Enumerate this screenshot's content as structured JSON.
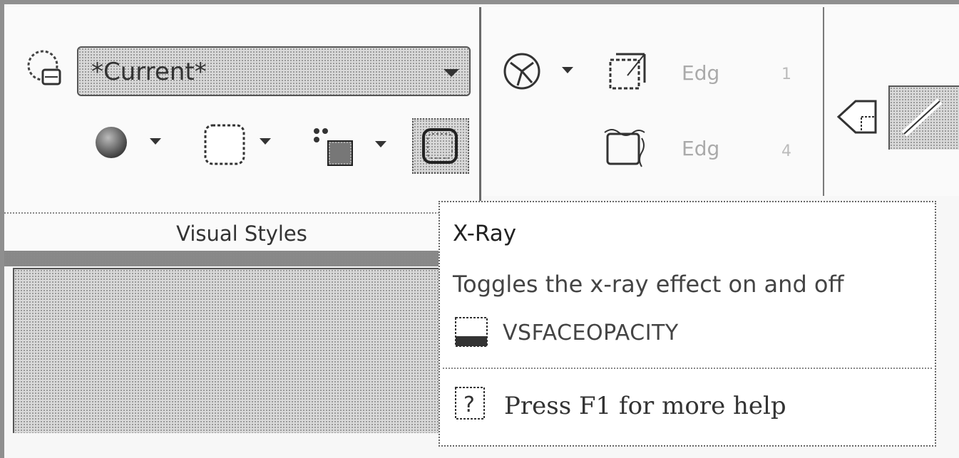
{
  "visual_styles_panel": {
    "dropdown_value": "*Current*",
    "title": "Visual Styles",
    "icons": [
      "visual-style-manager-icon",
      "shading-icon",
      "edge-style-icon",
      "shadow-cube-icon",
      "xray-icon"
    ]
  },
  "edge_panel": {
    "labels": [
      "Edg",
      "Edg"
    ],
    "numbers": [
      "1",
      "4"
    ],
    "icons": [
      "edge-effects-icon",
      "isolines-icon",
      "jitter-icon"
    ]
  },
  "right_panel": {
    "icons": [
      "tag-icon",
      "edit-icon"
    ]
  },
  "tooltip": {
    "title": "X-Ray",
    "description": "Toggles the x-ray effect on and off",
    "variable": "VSFACEOPACITY",
    "help": "Press F1 for more help"
  }
}
